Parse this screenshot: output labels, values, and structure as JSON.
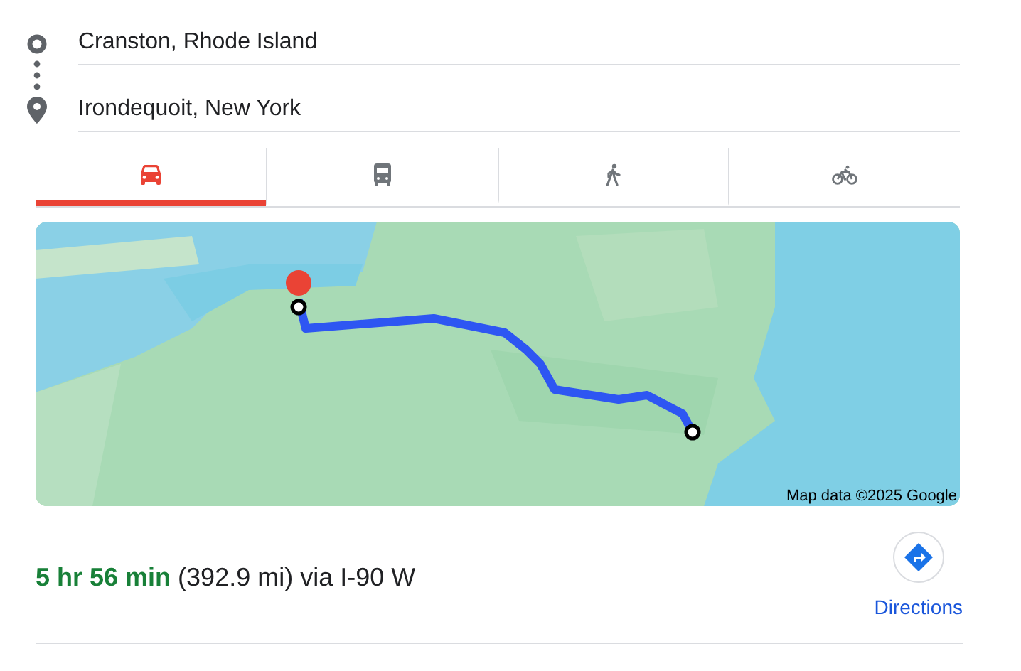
{
  "route": {
    "origin": "Cranston, Rhode Island",
    "destination": "Irondequoit, New York"
  },
  "modes": [
    {
      "kind": "car",
      "selected": true
    },
    {
      "kind": "transit",
      "selected": false
    },
    {
      "kind": "walk",
      "selected": false
    },
    {
      "kind": "bike",
      "selected": false
    }
  ],
  "map": {
    "kind": "picture",
    "attribution": "Map data ©2025 Google"
  },
  "summary": {
    "duration": "5 hr 56 min",
    "details": "(392.9 mi) via I-90 W"
  },
  "directions_button": {
    "label": "Directions"
  }
}
